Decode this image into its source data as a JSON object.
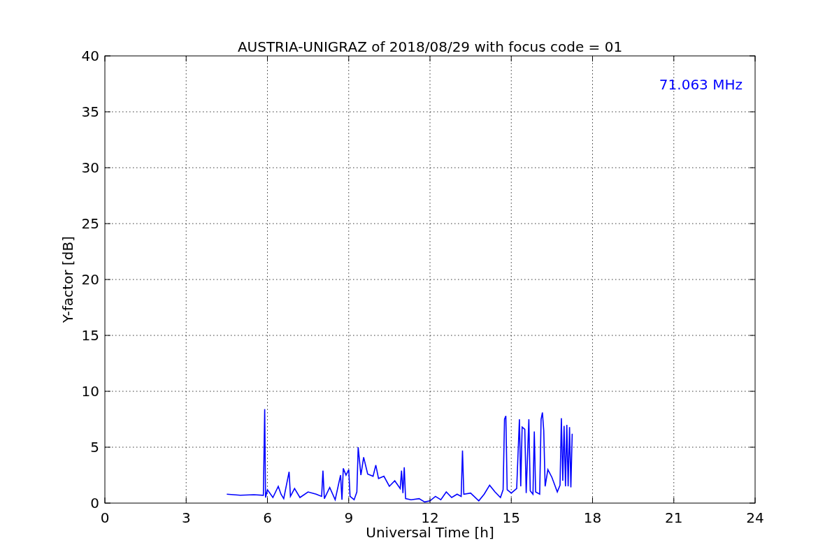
{
  "chart_data": {
    "type": "line",
    "title": "AUSTRIA-UNIGRAZ of 2018/08/29 with focus code = 01",
    "xlabel": "Universal Time [h]",
    "ylabel": "Y-factor [dB]",
    "x": [
      4.5,
      5.0,
      5.5,
      5.85,
      5.9,
      5.93,
      6.0,
      6.2,
      6.4,
      6.5,
      6.6,
      6.8,
      6.85,
      7.0,
      7.2,
      7.5,
      7.8,
      8.0,
      8.05,
      8.1,
      8.3,
      8.5,
      8.7,
      8.75,
      8.8,
      8.9,
      9.0,
      9.05,
      9.2,
      9.3,
      9.35,
      9.45,
      9.55,
      9.7,
      9.9,
      10.0,
      10.1,
      10.3,
      10.5,
      10.7,
      10.9,
      10.95,
      11.0,
      11.05,
      11.1,
      11.3,
      11.6,
      11.8,
      12.0,
      12.2,
      12.4,
      12.6,
      12.8,
      13.0,
      13.15,
      13.2,
      13.25,
      13.5,
      13.8,
      14.0,
      14.2,
      14.4,
      14.6,
      14.7,
      14.75,
      14.8,
      14.85,
      15.0,
      15.2,
      15.3,
      15.35,
      15.4,
      15.5,
      15.55,
      15.65,
      15.7,
      15.8,
      15.85,
      15.9,
      16.05,
      16.1,
      16.15,
      16.2,
      16.25,
      16.35,
      16.5,
      16.7,
      16.8,
      16.85,
      16.9,
      16.95,
      17.0,
      17.05,
      17.1,
      17.15,
      17.2,
      17.25
    ],
    "series": [
      {
        "color": "#0000ff",
        "values": [
          0.8,
          0.7,
          0.75,
          0.7,
          8.4,
          0.5,
          1.2,
          0.5,
          1.5,
          0.8,
          0.4,
          2.8,
          0.6,
          1.3,
          0.5,
          1.0,
          0.8,
          0.6,
          2.9,
          0.4,
          1.4,
          0.3,
          2.5,
          0.3,
          3.1,
          2.5,
          3.0,
          0.6,
          0.3,
          1.0,
          5.0,
          2.5,
          4.1,
          2.6,
          2.4,
          3.4,
          2.2,
          2.4,
          1.5,
          2.0,
          1.3,
          2.9,
          0.9,
          3.2,
          0.4,
          0.3,
          0.4,
          0.1,
          0.2,
          0.6,
          0.3,
          1.0,
          0.5,
          0.8,
          0.6,
          4.7,
          0.8,
          0.9,
          0.2,
          0.8,
          1.6,
          1.0,
          0.5,
          1.2,
          7.5,
          7.8,
          1.2,
          0.9,
          1.3,
          7.5,
          1.5,
          6.8,
          6.6,
          0.9,
          7.5,
          1.1,
          0.8,
          6.4,
          1.0,
          0.8,
          7.5,
          8.1,
          6.5,
          1.5,
          3.0,
          2.3,
          1.0,
          1.6,
          7.6,
          2.0,
          6.9,
          1.5,
          7.0,
          1.5,
          6.8,
          1.4,
          6.2
        ]
      }
    ],
    "xlim": [
      0,
      24
    ],
    "ylim": [
      0,
      40
    ],
    "xticks": [
      0,
      3,
      6,
      9,
      12,
      15,
      18,
      21,
      24
    ],
    "yticks": [
      0,
      5,
      10,
      15,
      20,
      25,
      30,
      35,
      40
    ],
    "grid": true,
    "annotations": [
      {
        "text": "71.063 MHz"
      }
    ]
  }
}
